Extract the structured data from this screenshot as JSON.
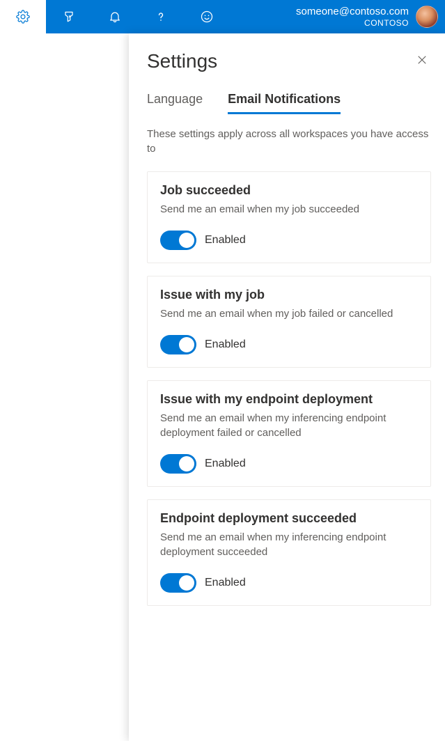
{
  "account": {
    "email": "someone@contoso.com",
    "org": "CONTOSO"
  },
  "panel": {
    "title": "Settings"
  },
  "tabs": {
    "language": "Language",
    "email_notifications": "Email Notifications"
  },
  "description": "These settings apply across all workspaces you have access to",
  "cards": [
    {
      "title": "Job succeeded",
      "desc": "Send me an email when my job succeeded",
      "state": "Enabled"
    },
    {
      "title": "Issue with my job",
      "desc": "Send me an email when my job failed or cancelled",
      "state": "Enabled"
    },
    {
      "title": "Issue with my endpoint deployment",
      "desc": "Send me an email when my inferencing endpoint deployment failed or cancelled",
      "state": "Enabled"
    },
    {
      "title": "Endpoint deployment succeeded",
      "desc": "Send me an email when my inferencing endpoint deployment succeeded",
      "state": "Enabled"
    }
  ]
}
